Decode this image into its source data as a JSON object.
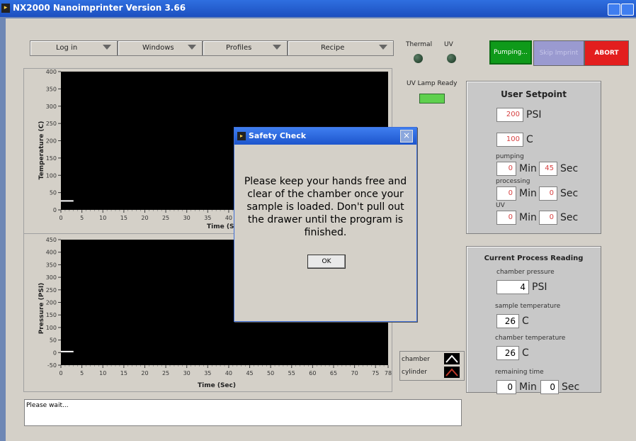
{
  "window": {
    "title": "NX2000 Nanoimprinter Version 3.66"
  },
  "menus": [
    {
      "label": "Log in"
    },
    {
      "label": "Windows"
    },
    {
      "label": "Profiles"
    },
    {
      "label": "Recipe"
    }
  ],
  "indicators": {
    "thermal_label": "Thermal",
    "uv_label": "UV",
    "uv_lamp_ready_label": "UV Lamp Ready"
  },
  "buttons": {
    "pumping": "Pumping...",
    "skip_imprint": "Skip Imprint",
    "abort": "ABORT"
  },
  "setpoint": {
    "title": "User Setpoint",
    "pressure": "200",
    "pressure_unit": "PSI",
    "temperature": "100",
    "temperature_unit": "C",
    "pumping_label": "pumping",
    "pumping_min": "0",
    "pumping_sec": "45",
    "processing_label": "processing",
    "processing_min": "0",
    "processing_sec": "0",
    "uv_label": "UV",
    "uv_min": "0",
    "uv_sec": "0",
    "min_unit": "Min",
    "sec_unit": "Sec"
  },
  "reading": {
    "title": "Current Process Reading",
    "chamber_pressure_label": "chamber pressure",
    "chamber_pressure": "4",
    "pressure_unit": "PSI",
    "sample_temperature_label": "sample temperature",
    "sample_temperature": "26",
    "temp_unit": "C",
    "chamber_temperature_label": "chamber temperature",
    "chamber_temperature": "26",
    "remaining_time_label": "remaining time",
    "remaining_min": "0",
    "remaining_sec": "0",
    "min_unit": "Min",
    "sec_unit": "Sec"
  },
  "legend": {
    "chamber": "chamber",
    "cylinder": "cylinder"
  },
  "chart_data": [
    {
      "type": "line",
      "ylabel": "Temperature (C)",
      "xlabel": "Time (S",
      "ylim": [
        0,
        400
      ],
      "yticks": [
        "400",
        "350",
        "300",
        "250",
        "200",
        "150",
        "100",
        "50",
        "0"
      ],
      "xticks": [
        "0",
        "5",
        "10",
        "15",
        "20",
        "25",
        "30",
        "35",
        "40"
      ],
      "series": [
        {
          "x": [
            0,
            3
          ],
          "y": [
            26,
            26
          ]
        }
      ]
    },
    {
      "type": "line",
      "ylabel": "Pressure (PSI)",
      "xlabel": "Time (Sec)",
      "ylim": [
        -50,
        450
      ],
      "yticks": [
        "450",
        "400",
        "350",
        "300",
        "250",
        "200",
        "150",
        "100",
        "50",
        "0",
        "-50"
      ],
      "xticks": [
        "0",
        "5",
        "10",
        "15",
        "20",
        "25",
        "30",
        "35",
        "40",
        "45",
        "50",
        "55",
        "60",
        "65",
        "70",
        "75",
        "78"
      ],
      "series": [
        {
          "x": [
            0,
            3
          ],
          "y": [
            4,
            4
          ]
        }
      ]
    }
  ],
  "dialog": {
    "title": "Safety Check",
    "message": "Please keep your hands free and clear of the chamber once your sample is loaded. Don't pull out the drawer until the program is finished.",
    "ok": "OK"
  },
  "status": {
    "text": "Please wait..."
  }
}
